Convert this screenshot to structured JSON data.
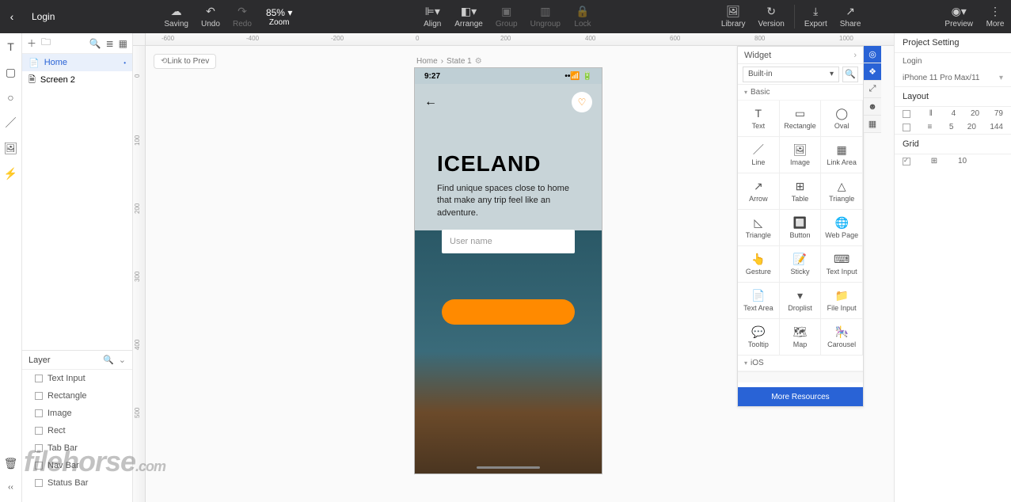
{
  "app_title": "Login",
  "toolbar": {
    "saving": "Saving",
    "undo": "Undo",
    "redo": "Redo",
    "zoom_value": "85%",
    "zoom_label": "Zoom",
    "align": "Align",
    "arrange": "Arrange",
    "group": "Group",
    "ungroup": "Ungroup",
    "lock": "Lock",
    "library": "Library",
    "version": "Version",
    "export": "Export",
    "share": "Share",
    "preview": "Preview",
    "more": "More"
  },
  "pages": {
    "items": [
      {
        "label": "Home",
        "active": true
      },
      {
        "label": "Screen 2",
        "active": false
      }
    ]
  },
  "link_pill": "Link to Prev",
  "breadcrumb": {
    "page": "Home",
    "sep": "›",
    "state": "State 1"
  },
  "device": {
    "time": "9:27",
    "title": "ICELAND",
    "subtitle": "Find unique spaces close to home that make any trip feel like an adventure.",
    "input_placeholder": "User name"
  },
  "layer": {
    "title": "Layer",
    "items": [
      "Text Input",
      "Rectangle",
      "Image",
      "Rect",
      "Tab Bar",
      "Nav Bar",
      "Status Bar"
    ]
  },
  "widget": {
    "title": "Widget",
    "dropdown": "Built-in",
    "cat_basic": "Basic",
    "cat_ios": "iOS",
    "more": "More Resources",
    "items": [
      "Text",
      "Rectangle",
      "Oval",
      "Line",
      "Image",
      "Link Area",
      "Arrow",
      "Table",
      "Triangle",
      "Triangle",
      "Button",
      "Web Page",
      "Gesture",
      "Sticky",
      "Text Input",
      "Text Area",
      "Droplist",
      "File Input",
      "Tooltip",
      "Map",
      "Carousel"
    ]
  },
  "props": {
    "title": "Project Setting",
    "project": "Login",
    "device": "iPhone 11 Pro Max/11",
    "layout_title": "Layout",
    "grid_title": "Grid",
    "layout_rows": [
      {
        "a": "4",
        "b": "20",
        "c": "79"
      },
      {
        "a": "5",
        "b": "20",
        "c": "144"
      }
    ],
    "grid_val": "10"
  },
  "ruler_h": [
    "-600",
    "-400",
    "-200",
    "0",
    "200",
    "400",
    "600",
    "800",
    "1000"
  ],
  "ruler_v": [
    "0",
    "100",
    "200",
    "300",
    "400",
    "500"
  ],
  "watermark": {
    "brand": "filehorse",
    "dom": ".com"
  }
}
